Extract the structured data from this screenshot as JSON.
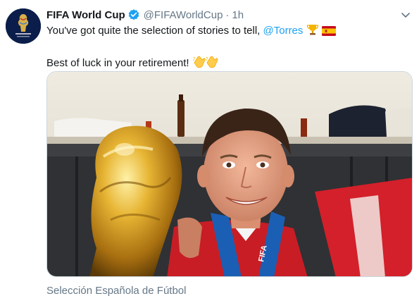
{
  "tweet": {
    "author_name": "FIFA World Cup",
    "handle": "@FIFAWorldCup",
    "separator": "·",
    "time": "1h",
    "text_prefix": "You've got quite the selection of stories to tell, ",
    "mention": "@Torres",
    "line2": "Best of luck in your retirement! ",
    "avatar_logo_text": "FIFA WORLD CUP RUSSIA 2018",
    "media_caption": "Selección Española de Fútbol",
    "scarf_text": "FIFA",
    "icons": [
      "verified-badge-icon",
      "chevron-down-icon",
      "trophy-emoji",
      "spain-flag-emoji",
      "clapping-hands-emoji"
    ]
  },
  "colors": {
    "link": "#1da1f2",
    "verified": "#1da1f2",
    "muted": "#657786"
  }
}
